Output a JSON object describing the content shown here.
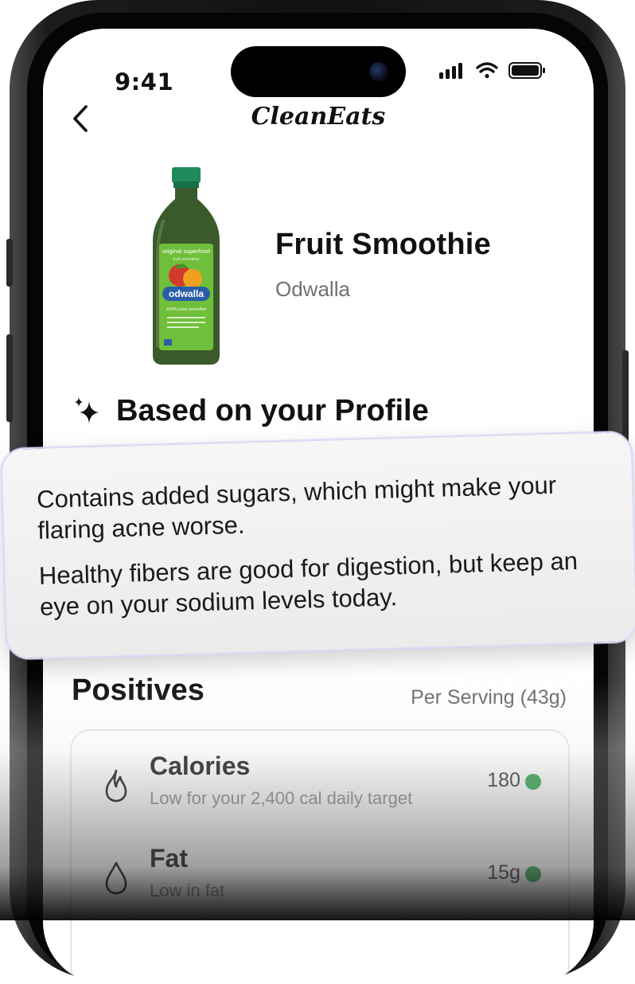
{
  "status_bar": {
    "time": "9:41"
  },
  "header": {
    "app_title": "CleanEats"
  },
  "product": {
    "name": "Fruit Smoothie",
    "brand": "Odwalla",
    "label": {
      "tagline": "original superfood",
      "subtag": "fruit smoothie",
      "logo": "odwalla",
      "descriptor": "100% juice smoothie"
    }
  },
  "profile": {
    "heading": "Based on your Profile"
  },
  "callout": {
    "line1": "Contains added sugars, which might make your flaring acne worse.",
    "line2": "Healthy fibers are good for digestion, but keep an eye on your sodium levels today."
  },
  "positives": {
    "title": "Positives",
    "per_serving": "Per Serving (43g)",
    "items": [
      {
        "name": "Calories",
        "note": "Low for your 2,400 cal daily target",
        "value": "180",
        "icon": "flame-icon",
        "status_color": "#2ea44f"
      },
      {
        "name": "Fat",
        "note": "Low in fat",
        "value": "15g",
        "icon": "drop-icon",
        "status_color": "#2ea44f"
      }
    ]
  },
  "colors": {
    "accent_green": "#2ea44f",
    "bottle_green": "#3b5a2c",
    "cap_green": "#1f8a5a"
  }
}
